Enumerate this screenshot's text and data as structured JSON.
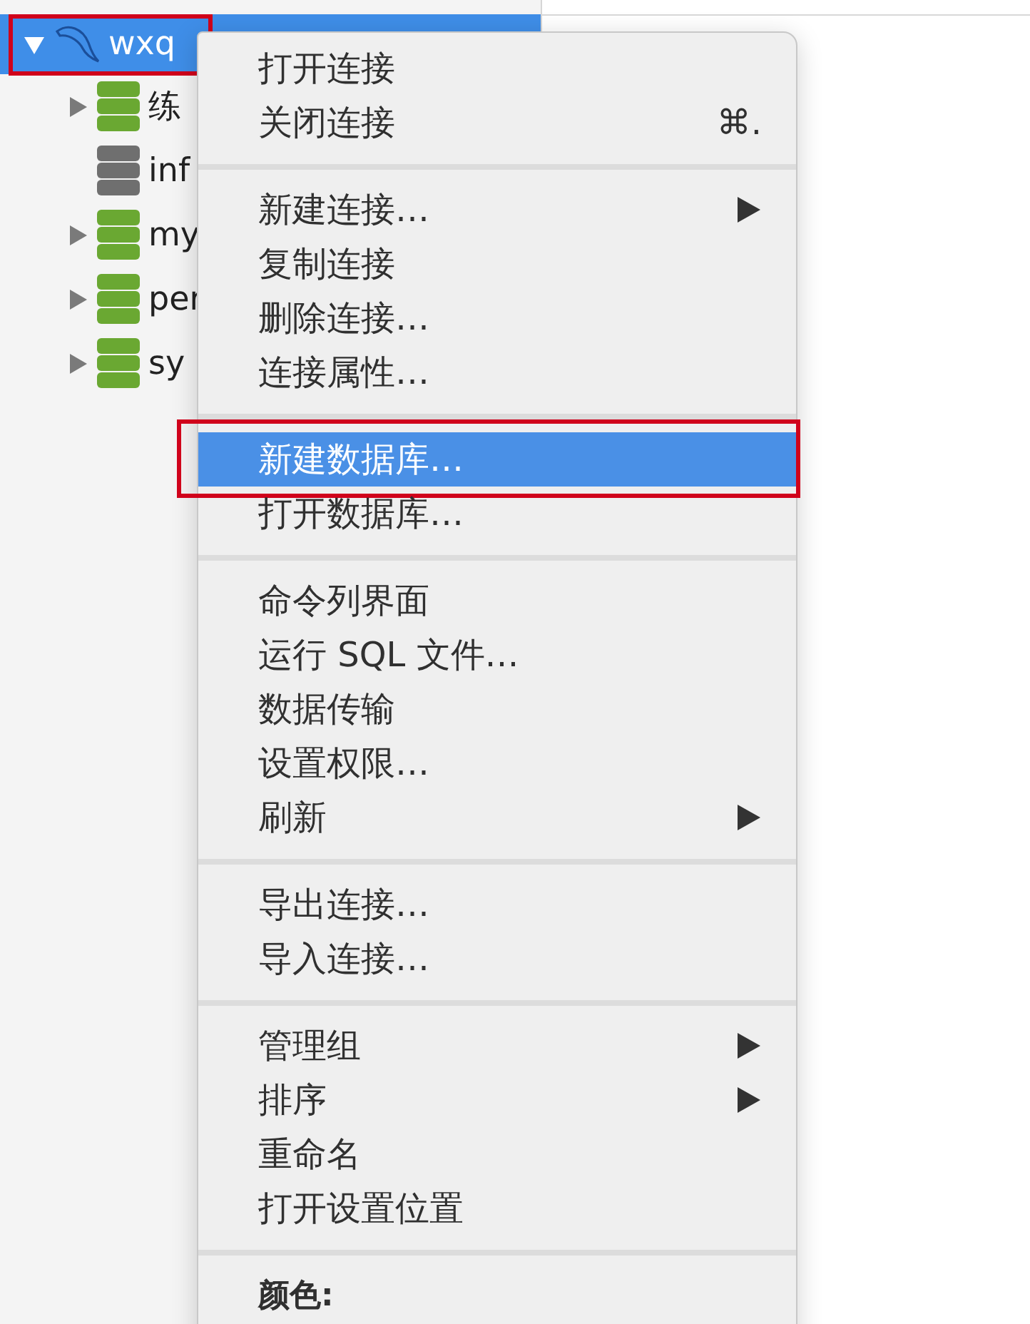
{
  "sidebar": {
    "tree": [
      {
        "label": "wxq",
        "expanded": true,
        "selected": true,
        "highlighted": true,
        "children": [
          {
            "label": "练",
            "expandable": true,
            "color": "#6aa832"
          },
          {
            "label": "inf",
            "expandable": false,
            "color": "#6f6f6f"
          },
          {
            "label": "my",
            "expandable": true,
            "color": "#6aa832"
          },
          {
            "label": "per",
            "expandable": true,
            "color": "#6aa832"
          },
          {
            "label": "sy",
            "expandable": true,
            "color": "#6aa832"
          }
        ]
      }
    ]
  },
  "context_menu": {
    "groups": [
      {
        "items": [
          {
            "kind": "command",
            "label": "打开连接",
            "submenu": false,
            "selected": false,
            "highlighted": false
          },
          {
            "kind": "command",
            "label": "关闭连接",
            "shortcut": "⌘.",
            "submenu": false,
            "selected": false,
            "highlighted": false
          }
        ]
      },
      {
        "items": [
          {
            "kind": "command",
            "label": "新建连接…",
            "submenu": true,
            "selected": false,
            "highlighted": false
          },
          {
            "kind": "command",
            "label": "复制连接",
            "submenu": false,
            "selected": false,
            "highlighted": false
          },
          {
            "kind": "command",
            "label": "删除连接…",
            "submenu": false,
            "selected": false,
            "highlighted": false
          },
          {
            "kind": "command",
            "label": "连接属性…",
            "submenu": false,
            "selected": false,
            "highlighted": false
          }
        ]
      },
      {
        "items": [
          {
            "kind": "command",
            "label": "新建数据库…",
            "submenu": false,
            "selected": true,
            "highlighted": true
          },
          {
            "kind": "command",
            "label": "打开数据库…",
            "submenu": false,
            "selected": false,
            "highlighted": false
          }
        ]
      },
      {
        "items": [
          {
            "kind": "command",
            "label": "命令列界面",
            "submenu": false,
            "selected": false,
            "highlighted": false
          },
          {
            "kind": "command",
            "label": "运行 SQL 文件…",
            "submenu": false,
            "selected": false,
            "highlighted": false
          },
          {
            "kind": "command",
            "label": "数据传输",
            "submenu": false,
            "selected": false,
            "highlighted": false
          },
          {
            "kind": "command",
            "label": "设置权限…",
            "submenu": false,
            "selected": false,
            "highlighted": false
          },
          {
            "kind": "command",
            "label": "刷新",
            "submenu": true,
            "selected": false,
            "highlighted": false
          }
        ]
      },
      {
        "items": [
          {
            "kind": "command",
            "label": "导出连接…",
            "submenu": false,
            "selected": false,
            "highlighted": false
          },
          {
            "kind": "command",
            "label": "导入连接…",
            "submenu": false,
            "selected": false,
            "highlighted": false
          }
        ]
      },
      {
        "items": [
          {
            "kind": "command",
            "label": "管理组",
            "submenu": true,
            "selected": false,
            "highlighted": false
          },
          {
            "kind": "command",
            "label": "排序",
            "submenu": true,
            "selected": false,
            "highlighted": false
          },
          {
            "kind": "command",
            "label": "重命名",
            "submenu": false,
            "selected": false,
            "highlighted": false
          },
          {
            "kind": "command",
            "label": "打开设置位置",
            "submenu": false,
            "selected": false,
            "highlighted": false
          }
        ]
      },
      {
        "items": [
          {
            "kind": "header",
            "label": "颜色:"
          }
        ]
      }
    ]
  }
}
